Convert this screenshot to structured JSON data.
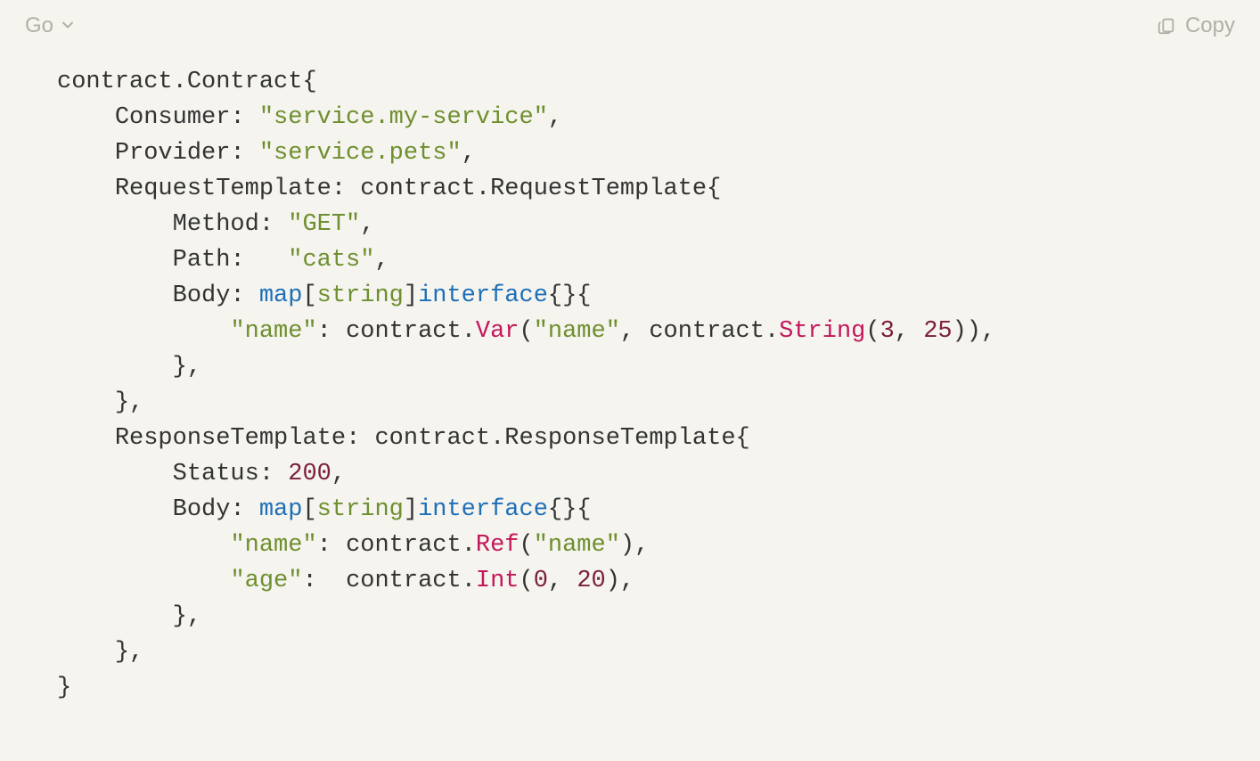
{
  "toolbar": {
    "language": "Go",
    "copy_label": "Copy"
  },
  "code": {
    "tokens": [
      {
        "c": "pln",
        "t": "contract"
      },
      {
        "c": "pun-dark",
        "t": "."
      },
      {
        "c": "pln",
        "t": "Contract"
      },
      {
        "c": "brace",
        "t": "{"
      },
      {
        "nl": true
      },
      {
        "indent": 1
      },
      {
        "c": "pln",
        "t": "Consumer"
      },
      {
        "c": "pun-dark",
        "t": ": "
      },
      {
        "c": "str",
        "t": "\"service.my-service\""
      },
      {
        "c": "pun-dark",
        "t": ","
      },
      {
        "nl": true
      },
      {
        "indent": 1
      },
      {
        "c": "pln",
        "t": "Provider"
      },
      {
        "c": "pun-dark",
        "t": ": "
      },
      {
        "c": "str",
        "t": "\"service.pets\""
      },
      {
        "c": "pun-dark",
        "t": ","
      },
      {
        "nl": true
      },
      {
        "indent": 1
      },
      {
        "c": "pln",
        "t": "RequestTemplate"
      },
      {
        "c": "pun-dark",
        "t": ": "
      },
      {
        "c": "pln",
        "t": "contract"
      },
      {
        "c": "pun-dark",
        "t": "."
      },
      {
        "c": "pln",
        "t": "RequestTemplate"
      },
      {
        "c": "brace",
        "t": "{"
      },
      {
        "nl": true
      },
      {
        "indent": 2
      },
      {
        "c": "pln",
        "t": "Method"
      },
      {
        "c": "pun-dark",
        "t": ": "
      },
      {
        "c": "str",
        "t": "\"GET\""
      },
      {
        "c": "pun-dark",
        "t": ","
      },
      {
        "nl": true
      },
      {
        "indent": 2
      },
      {
        "c": "pln",
        "t": "Path"
      },
      {
        "c": "pun-dark",
        "t": ":   "
      },
      {
        "c": "str",
        "t": "\"cats\""
      },
      {
        "c": "pun-dark",
        "t": ","
      },
      {
        "nl": true
      },
      {
        "indent": 2
      },
      {
        "c": "pln",
        "t": "Body"
      },
      {
        "c": "pun-dark",
        "t": ": "
      },
      {
        "c": "kw",
        "t": "map"
      },
      {
        "c": "pun-dark",
        "t": "["
      },
      {
        "c": "typ",
        "t": "string"
      },
      {
        "c": "pun-dark",
        "t": "]"
      },
      {
        "c": "kw",
        "t": "interface"
      },
      {
        "c": "brace",
        "t": "{}{"
      },
      {
        "nl": true
      },
      {
        "indent": 3
      },
      {
        "c": "str",
        "t": "\"name\""
      },
      {
        "c": "pun-dark",
        "t": ": "
      },
      {
        "c": "pln",
        "t": "contract"
      },
      {
        "c": "pun-dark",
        "t": "."
      },
      {
        "c": "fn",
        "t": "Var"
      },
      {
        "c": "pun-dark",
        "t": "("
      },
      {
        "c": "str",
        "t": "\"name\""
      },
      {
        "c": "pun-dark",
        "t": ", "
      },
      {
        "c": "pln",
        "t": "contract"
      },
      {
        "c": "pun-dark",
        "t": "."
      },
      {
        "c": "fn",
        "t": "String"
      },
      {
        "c": "pun-dark",
        "t": "("
      },
      {
        "c": "num",
        "t": "3"
      },
      {
        "c": "pun-dark",
        "t": ", "
      },
      {
        "c": "num",
        "t": "25"
      },
      {
        "c": "pun-dark",
        "t": ")),"
      },
      {
        "nl": true
      },
      {
        "indent": 2
      },
      {
        "c": "brace",
        "t": "},"
      },
      {
        "nl": true
      },
      {
        "indent": 1
      },
      {
        "c": "brace",
        "t": "},"
      },
      {
        "nl": true
      },
      {
        "indent": 1
      },
      {
        "c": "pln",
        "t": "ResponseTemplate"
      },
      {
        "c": "pun-dark",
        "t": ": "
      },
      {
        "c": "pln",
        "t": "contract"
      },
      {
        "c": "pun-dark",
        "t": "."
      },
      {
        "c": "pln",
        "t": "ResponseTemplate"
      },
      {
        "c": "brace",
        "t": "{"
      },
      {
        "nl": true
      },
      {
        "indent": 2
      },
      {
        "c": "pln",
        "t": "Status"
      },
      {
        "c": "pun-dark",
        "t": ": "
      },
      {
        "c": "num",
        "t": "200"
      },
      {
        "c": "pun-dark",
        "t": ","
      },
      {
        "nl": true
      },
      {
        "indent": 2
      },
      {
        "c": "pln",
        "t": "Body"
      },
      {
        "c": "pun-dark",
        "t": ": "
      },
      {
        "c": "kw",
        "t": "map"
      },
      {
        "c": "pun-dark",
        "t": "["
      },
      {
        "c": "typ",
        "t": "string"
      },
      {
        "c": "pun-dark",
        "t": "]"
      },
      {
        "c": "kw",
        "t": "interface"
      },
      {
        "c": "brace",
        "t": "{}{"
      },
      {
        "nl": true
      },
      {
        "indent": 3
      },
      {
        "c": "str",
        "t": "\"name\""
      },
      {
        "c": "pun-dark",
        "t": ": "
      },
      {
        "c": "pln",
        "t": "contract"
      },
      {
        "c": "pun-dark",
        "t": "."
      },
      {
        "c": "fn",
        "t": "Ref"
      },
      {
        "c": "pun-dark",
        "t": "("
      },
      {
        "c": "str",
        "t": "\"name\""
      },
      {
        "c": "pun-dark",
        "t": "),"
      },
      {
        "nl": true
      },
      {
        "indent": 3
      },
      {
        "c": "str",
        "t": "\"age\""
      },
      {
        "c": "pun-dark",
        "t": ":  "
      },
      {
        "c": "pln",
        "t": "contract"
      },
      {
        "c": "pun-dark",
        "t": "."
      },
      {
        "c": "fn",
        "t": "Int"
      },
      {
        "c": "pun-dark",
        "t": "("
      },
      {
        "c": "num",
        "t": "0"
      },
      {
        "c": "pun-dark",
        "t": ", "
      },
      {
        "c": "num",
        "t": "20"
      },
      {
        "c": "pun-dark",
        "t": "),"
      },
      {
        "nl": true
      },
      {
        "indent": 2
      },
      {
        "c": "brace",
        "t": "},"
      },
      {
        "nl": true
      },
      {
        "indent": 1
      },
      {
        "c": "brace",
        "t": "},"
      },
      {
        "nl": true
      },
      {
        "c": "brace",
        "t": "}"
      }
    ]
  }
}
